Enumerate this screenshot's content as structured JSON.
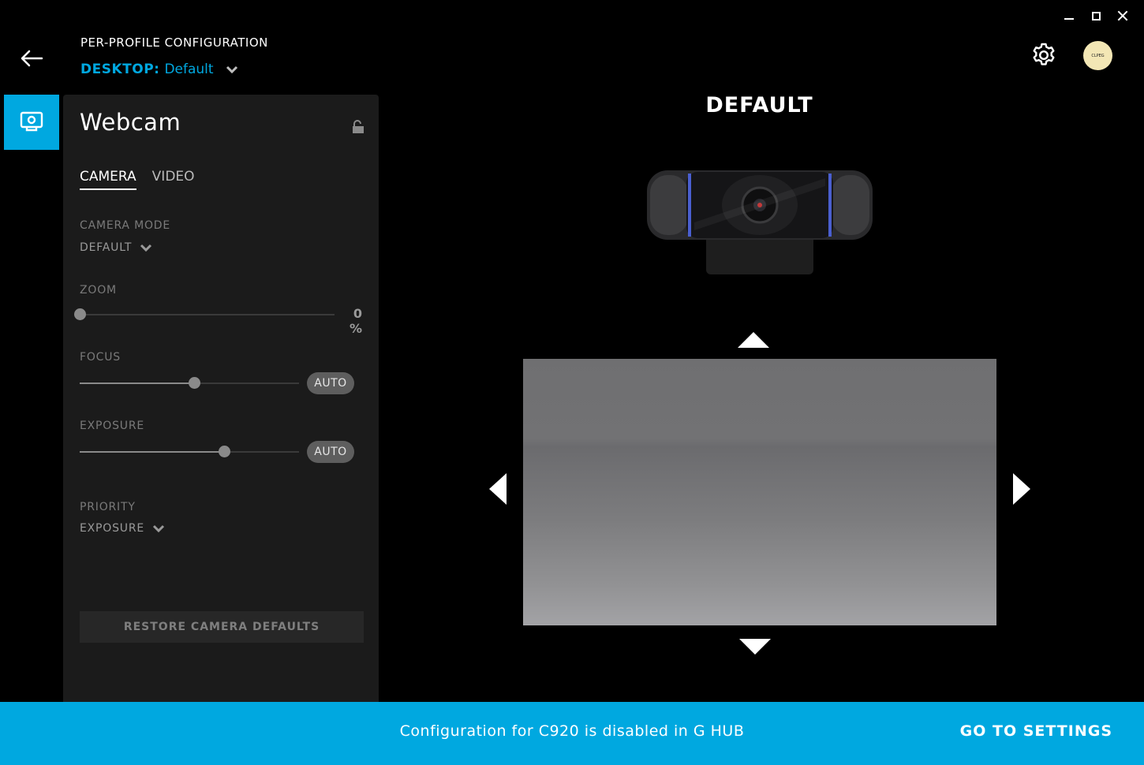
{
  "header": {
    "caption": "PER-PROFILE CONFIGURATION",
    "device_label": "DESKTOP:",
    "profile_name": "Default",
    "avatar_text": "CLPEG"
  },
  "icons": {
    "back": "back-arrow-icon",
    "settings": "gear-icon",
    "device_tab": "webcam-icon",
    "lock": "unlock-icon",
    "nav_up": "triangle-up-icon",
    "nav_down": "triangle-down-icon",
    "nav_left": "triangle-left-icon",
    "nav_right": "triangle-right-icon"
  },
  "colors": {
    "accent": "#00a8e0",
    "panel_bg": "#1b1b1b",
    "app_bg": "#000000"
  },
  "panel": {
    "title": "Webcam",
    "tabs": [
      {
        "label": "CAMERA",
        "active": true
      },
      {
        "label": "VIDEO",
        "active": false
      }
    ],
    "camera_mode": {
      "label": "CAMERA MODE",
      "value": "DEFAULT"
    },
    "zoom": {
      "label": "ZOOM",
      "value_text": "0 %",
      "level": 0
    },
    "focus": {
      "label": "FOCUS",
      "auto_label": "AUTO",
      "level": 0.52
    },
    "exposure": {
      "label": "EXPOSURE",
      "auto_label": "AUTO",
      "level": 0.66
    },
    "priority": {
      "label": "PRIORITY",
      "value": "EXPOSURE"
    },
    "restore_label": "RESTORE CAMERA DEFAULTS"
  },
  "main": {
    "title": "DEFAULT"
  },
  "banner": {
    "message": "Configuration for C920 is disabled in G HUB",
    "action_label": "GO TO SETTINGS"
  }
}
